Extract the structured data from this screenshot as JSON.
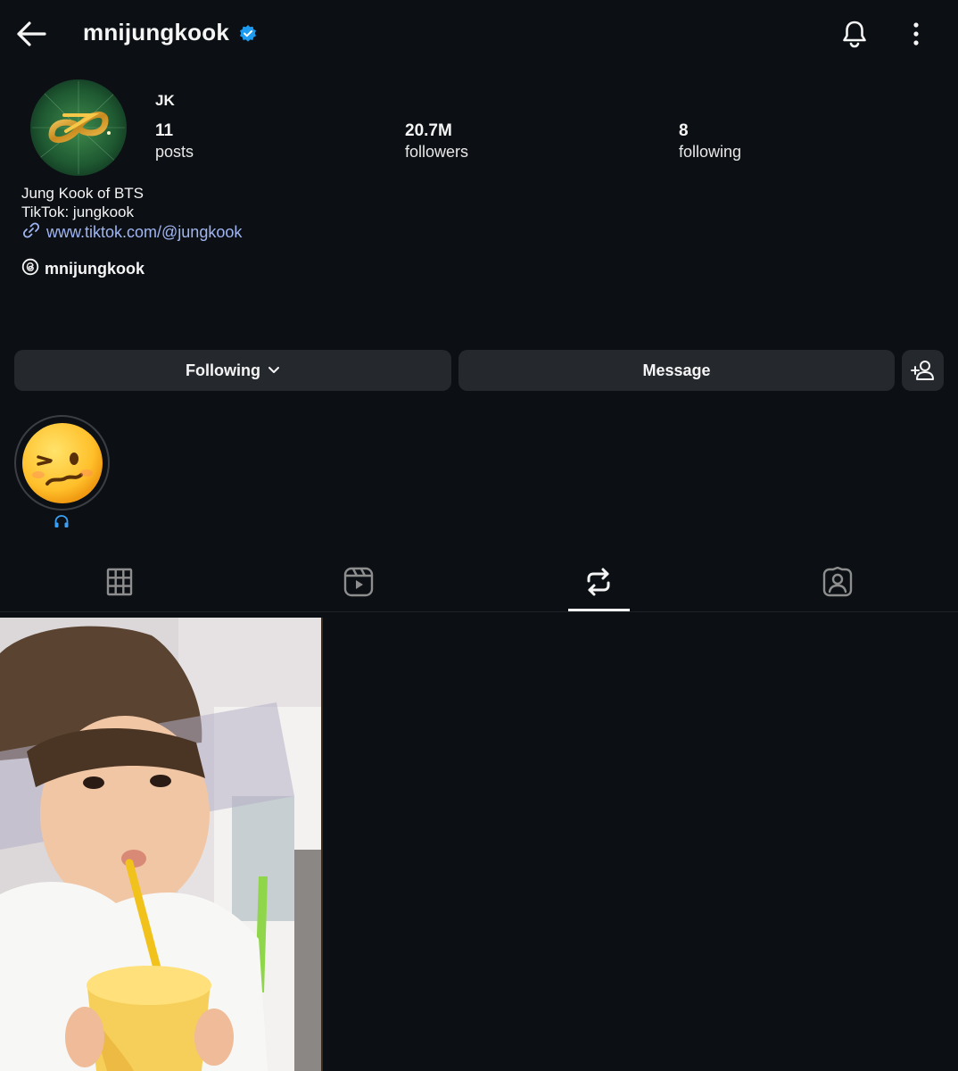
{
  "header": {
    "username": "mnijungkook",
    "verified": true
  },
  "profile": {
    "display_name": "JK",
    "stats": {
      "posts_count": "11",
      "posts_label": "posts",
      "followers_count": "20.7M",
      "followers_label": "followers",
      "following_count": "8",
      "following_label": "following"
    },
    "bio_lines": [
      "Jung Kook of BTS",
      "TikTok: jungkook"
    ],
    "link": "www.tiktok.com/@jungkook",
    "threads_handle": "mnijungkook"
  },
  "actions": {
    "following_label": "Following",
    "message_label": "Message"
  },
  "tabs": [
    {
      "icon": "grid-icon",
      "active": false
    },
    {
      "icon": "reels-icon",
      "active": false
    },
    {
      "icon": "reposts-icon",
      "active": true
    },
    {
      "icon": "tagged-icon",
      "active": false
    }
  ],
  "colors": {
    "background": "#0c1014",
    "button": "#25292e",
    "link": "#a0b5f2",
    "verified": "#1d9bf0"
  }
}
